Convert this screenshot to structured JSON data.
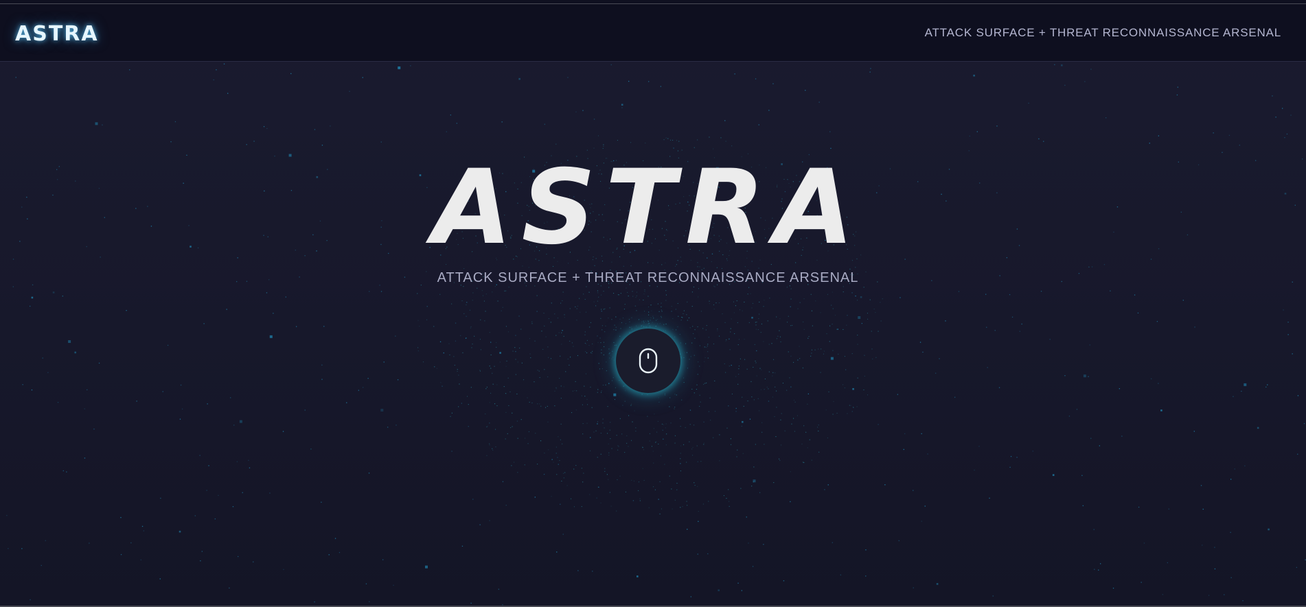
{
  "header": {
    "brand": "ASTRA",
    "tagline": "ATTACK SURFACE + THREAT RECONNAISSANCE ARSENAL"
  },
  "hero": {
    "title": "ASTRA",
    "subtitle": "ATTACK SURFACE + THREAT RECONNAISSANCE ARSENAL",
    "scroll_icon": "mouse-icon"
  },
  "colors": {
    "background": "#171829",
    "header_background": "#0e0f1f",
    "accent_glow": "#2cc4d6",
    "title_text": "#ececec",
    "muted_text": "#a9abc4",
    "particle": "#1f7fa8"
  }
}
